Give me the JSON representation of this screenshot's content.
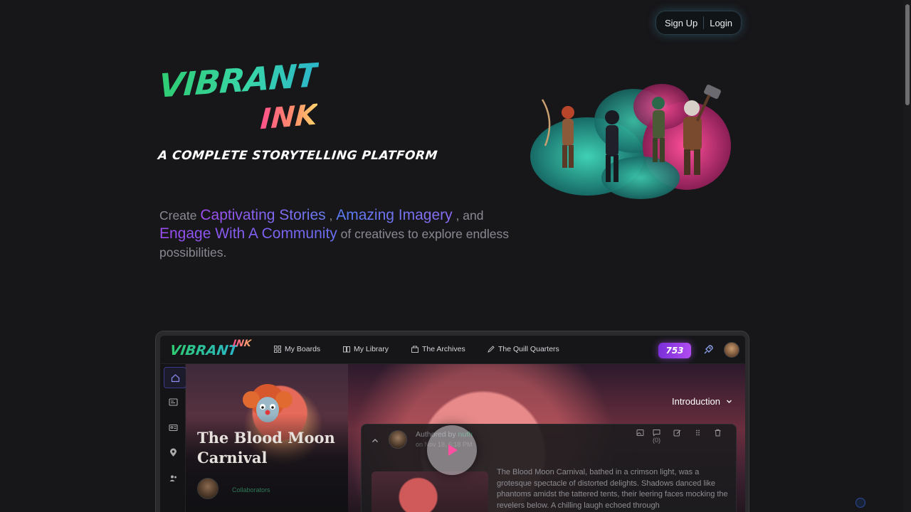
{
  "auth": {
    "signup": "Sign Up",
    "login": "Login"
  },
  "hero": {
    "logo_word1": "VIBRANT",
    "logo_word2": "INK",
    "tagline": "A Complete Storytelling Platform",
    "desc": {
      "p1": "Create ",
      "h1": "Captivating Stories",
      "p2": " , ",
      "h2": "Amazing Imagery",
      "p3": " , and ",
      "h3": "Engage With A Community",
      "p4": " of creatives to explore endless possibilities."
    }
  },
  "app": {
    "logo_word1": "VIBRANT",
    "logo_word2": "INK",
    "nav": [
      {
        "label": "My Boards",
        "icon": "grid-icon"
      },
      {
        "label": "My Library",
        "icon": "book-icon"
      },
      {
        "label": "The Archives",
        "icon": "archive-icon"
      },
      {
        "label": "The Quill Quarters",
        "icon": "pen-icon"
      }
    ],
    "credits": "753",
    "sidebar": [
      "home-icon",
      "boards-icon",
      "id-card-icon",
      "map-pin-icon",
      "users-icon"
    ],
    "story": {
      "title": "The Blood Moon Carnival",
      "collaborators_label": "Collaborators"
    },
    "section_dropdown": "Introduction",
    "post": {
      "author_prefix": "Authored by ",
      "author_name": "nuth",
      "date": "on Nov 18, 6:18 PM",
      "comment_count": "(0)",
      "body": "The Blood Moon Carnival, bathed in a crimson light, was a grotesque spectacle of distorted delights. Shadows danced like phantoms amidst the tattered tents, their leering faces mocking the revelers below. A chilling laugh echoed through"
    }
  },
  "colors": {
    "accent_purple": "#a04cf0",
    "accent_blue": "#5a7cf5",
    "logo_green": "#2ecc71",
    "logo_pink": "#ff4f8b"
  }
}
